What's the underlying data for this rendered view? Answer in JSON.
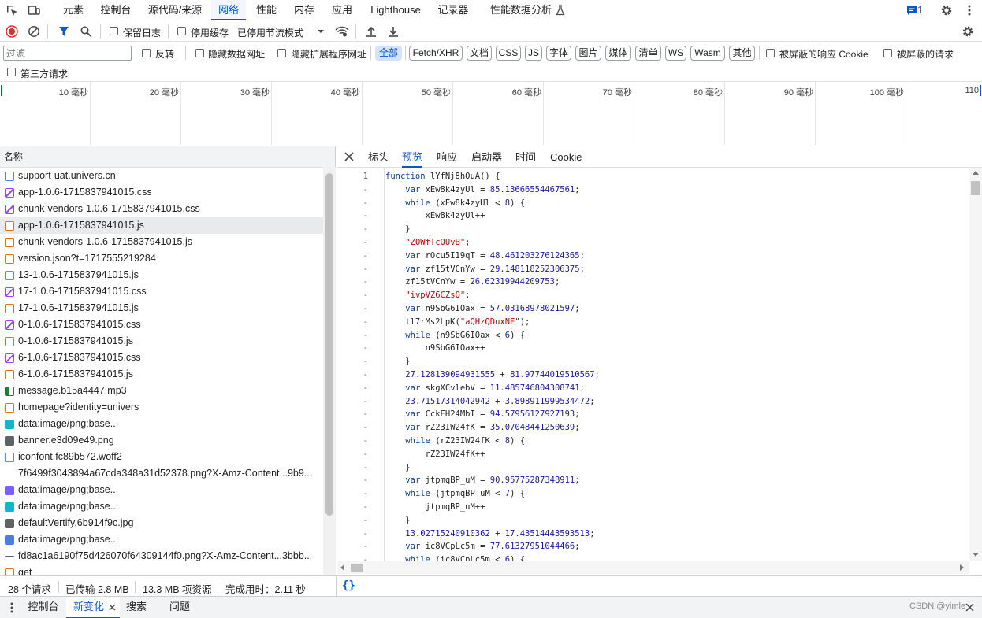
{
  "main_tabs": [
    "元素",
    "控制台",
    "源代码/来源",
    "网络",
    "性能",
    "内存",
    "应用",
    "Lighthouse",
    "记录器",
    "性能数据分析"
  ],
  "active_main_tab": "网络",
  "issues_count": "1",
  "toolbar": {
    "preserve_log": "保留日志",
    "disable_cache": "停用缓存",
    "throttling": "已停用节流模式"
  },
  "filter": {
    "placeholder": "过滤",
    "invert": "反转",
    "hide_data_urls": "隐藏数据网址",
    "hide_extension_urls": "隐藏扩展程序网址",
    "types": [
      "全部",
      "Fetch/XHR",
      "文档",
      "CSS",
      "JS",
      "字体",
      "图片",
      "媒体",
      "清单",
      "WS",
      "Wasm",
      "其他"
    ],
    "active_type": "全部",
    "blocked_cookies": "被屏蔽的响应 Cookie",
    "blocked_requests": "被屏蔽的请求",
    "third_party": "第三方请求"
  },
  "timeline_ticks": [
    "10 毫秒",
    "20 毫秒",
    "30 毫秒",
    "40 毫秒",
    "50 毫秒",
    "60 毫秒",
    "70 毫秒",
    "80 毫秒",
    "90 毫秒",
    "100 毫秒",
    "110"
  ],
  "name_header": "名称",
  "requests": [
    {
      "name": "support-uat.univers.cn",
      "type": "doc",
      "color": "#4a7fdb"
    },
    {
      "name": "app-1.0.6-1715837941015.css",
      "type": "css",
      "color": "#a142f4"
    },
    {
      "name": "chunk-vendors-1.0.6-1715837941015.css",
      "type": "css",
      "color": "#a142f4"
    },
    {
      "name": "app-1.0.6-1715837941015.js",
      "type": "js",
      "color": "#e8710a",
      "selected": true
    },
    {
      "name": "chunk-vendors-1.0.6-1715837941015.js",
      "type": "js",
      "color": "#e8710a"
    },
    {
      "name": "version.json?t=1717555219284",
      "type": "fetch",
      "color": "#e8710a"
    },
    {
      "name": "13-1.0.6-1715837941015.js",
      "type": "js",
      "color": "#e8710a"
    },
    {
      "name": "17-1.0.6-1715837941015.css",
      "type": "css",
      "color": "#a142f4"
    },
    {
      "name": "17-1.0.6-1715837941015.js",
      "type": "js",
      "color": "#e8710a"
    },
    {
      "name": "0-1.0.6-1715837941015.css",
      "type": "css",
      "color": "#a142f4"
    },
    {
      "name": "0-1.0.6-1715837941015.js",
      "type": "js",
      "color": "#e8710a"
    },
    {
      "name": "6-1.0.6-1715837941015.css",
      "type": "css",
      "color": "#a142f4"
    },
    {
      "name": "6-1.0.6-1715837941015.js",
      "type": "js",
      "color": "#e8710a"
    },
    {
      "name": "message.b15a4447.mp3",
      "type": "media",
      "color": "#188038"
    },
    {
      "name": "homepage?identity=univers",
      "type": "fetch",
      "color": "#e8710a"
    },
    {
      "name": "data:image/png;base...",
      "type": "img",
      "color": "#12b5cb"
    },
    {
      "name": "banner.e3d09e49.png",
      "type": "img",
      "color": "#5f6368"
    },
    {
      "name": "iconfont.fc89b572.woff2",
      "type": "font",
      "color": "#12b5cb"
    },
    {
      "name": "7f6499f3043894a67cda348a31d52378.png?X-Amz-Content...9b9...",
      "type": "none",
      "color": ""
    },
    {
      "name": "data:image/png;base...",
      "type": "img",
      "color": "#7b61ff"
    },
    {
      "name": "data:image/png;base...",
      "type": "img",
      "color": "#12b5cb"
    },
    {
      "name": "defaultVertify.6b914f9c.jpg",
      "type": "img",
      "color": "#5f6368"
    },
    {
      "name": "data:image/png;base...",
      "type": "img",
      "color": "#4a7fdb"
    },
    {
      "name": "fd8ac1a6190f75d426070f64309144f0.png?X-Amz-Content...3bbb...",
      "type": "other",
      "color": "#5f6368"
    },
    {
      "name": "get",
      "type": "fetch",
      "color": "#e8710a"
    }
  ],
  "detail_tabs": [
    "标头",
    "预览",
    "响应",
    "启动器",
    "时间",
    "Cookie"
  ],
  "active_detail_tab": "预览",
  "code_lines": [
    {
      "n": "1",
      "t": "function lYfNj8hOuA() {"
    },
    {
      "n": "-",
      "t": "    var xEw8k4zyUl = 85.13666554467561;"
    },
    {
      "n": "-",
      "t": "    while (xEw8k4zyUl < 8) {"
    },
    {
      "n": "-",
      "t": "        xEw8k4zyUl++"
    },
    {
      "n": "-",
      "t": "    }"
    },
    {
      "n": "-",
      "t": "    \"ZOWfTcOUvB\";"
    },
    {
      "n": "-",
      "t": "    var rOcu5I19qT = 48.461203276124365;"
    },
    {
      "n": "-",
      "t": "    var zf15tVCnYw = 29.148118252306375;"
    },
    {
      "n": "-",
      "t": "    zf15tVCnYw = 26.62319944209753;"
    },
    {
      "n": "-",
      "t": "    \"ivpVZ6CZsQ\";"
    },
    {
      "n": "-",
      "t": "    var n9SbG6IOax = 57.03168978021597;"
    },
    {
      "n": "-",
      "t": "    tl7rMs2LpK(\"aQHzQDuxNE\");"
    },
    {
      "n": "-",
      "t": "    while (n9SbG6IOax < 6) {"
    },
    {
      "n": "-",
      "t": "        n9SbG6IOax++"
    },
    {
      "n": "-",
      "t": "    }"
    },
    {
      "n": "-",
      "t": "    27.128139094931555 + 81.97744019510567;"
    },
    {
      "n": "-",
      "t": "    var skgXCvlebV = 11.485746804308741;"
    },
    {
      "n": "-",
      "t": "    23.71517314042942 + 3.898911999534472;"
    },
    {
      "n": "-",
      "t": "    var CckEH24MbI = 94.57956127927193;"
    },
    {
      "n": "-",
      "t": "    var rZ23IW24fK = 35.07048441250639;"
    },
    {
      "n": "-",
      "t": "    while (rZ23IW24fK < 8) {"
    },
    {
      "n": "-",
      "t": "        rZ23IW24fK++"
    },
    {
      "n": "-",
      "t": "    }"
    },
    {
      "n": "-",
      "t": "    var jtpmqBP_uM = 90.95775287348911;"
    },
    {
      "n": "-",
      "t": "    while (jtpmqBP_uM < 7) {"
    },
    {
      "n": "-",
      "t": "        jtpmqBP_uM++"
    },
    {
      "n": "-",
      "t": "    }"
    },
    {
      "n": "-",
      "t": "    13.02715240910362 + 17.43514443593513;"
    },
    {
      "n": "-",
      "t": "    var ic8VCpLc5m = 77.61327951044466;"
    },
    {
      "n": "-",
      "t": "    while (ic8VCpLc5m < 6) {"
    }
  ],
  "status": {
    "requests": "28 个请求",
    "transferred": "已传输 2.8 MB",
    "resources": "13.3 MB 项资源",
    "finish": "完成用时：2.11 秒"
  },
  "pretty_print": "{}",
  "drawer_tabs": [
    "控制台",
    "新变化",
    "搜索",
    "问题"
  ],
  "active_drawer_tab": "新变化",
  "watermark": "CSDN @yimle",
  "colors": {
    "accent": "#0b57d0",
    "record": "#d93025"
  }
}
